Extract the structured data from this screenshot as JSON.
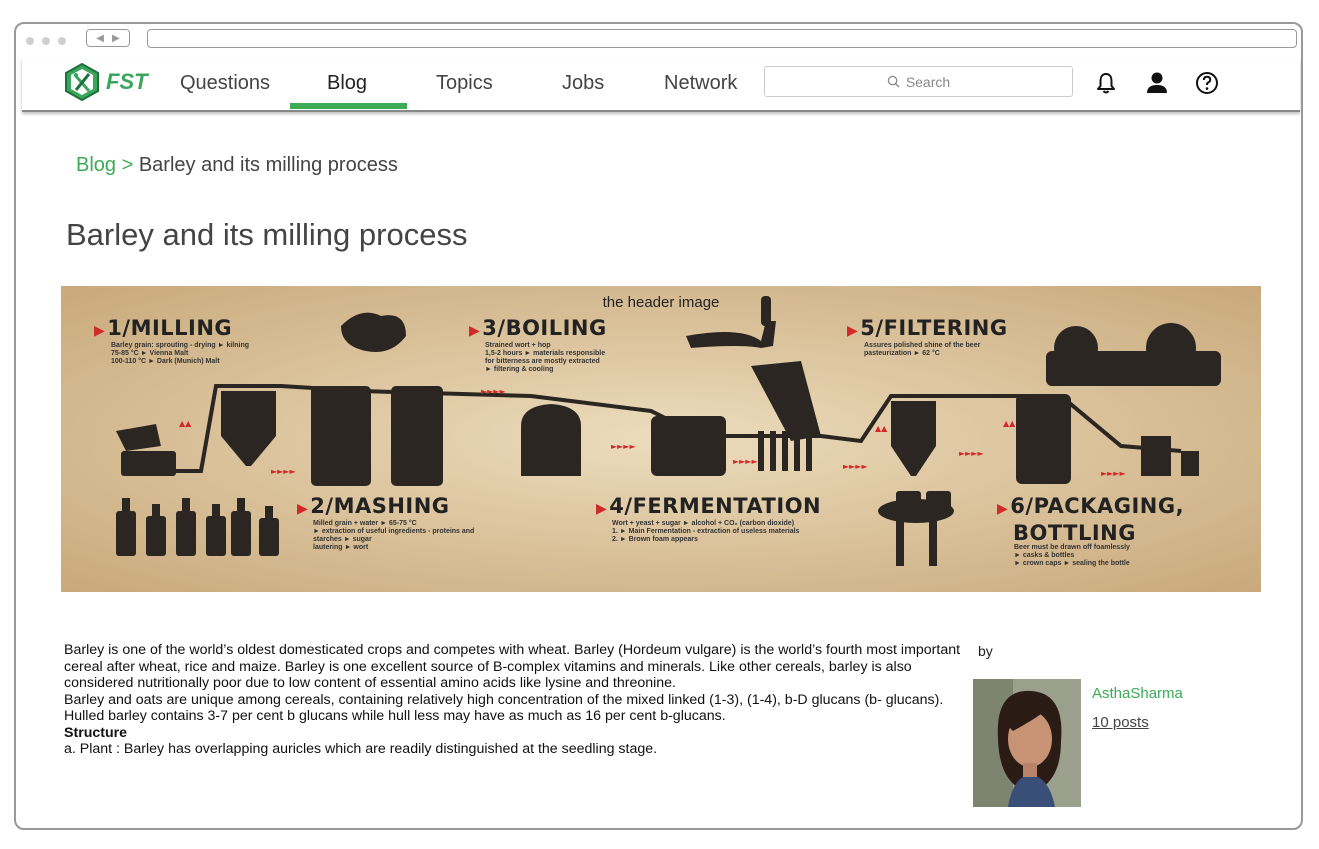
{
  "brand": {
    "logo_text": "FST",
    "logo_icon": "fork-knife-hexagon-icon",
    "accent": "#3dab55"
  },
  "nav": {
    "items": [
      "Questions",
      "Blog",
      "Topics",
      "Jobs",
      "Network"
    ],
    "active": "Blog",
    "search_placeholder": "Search"
  },
  "header_icons": [
    "bell-icon",
    "user-icon",
    "help-icon"
  ],
  "breadcrumb": {
    "parent": "Blog",
    "separator": ">",
    "current": "Barley and its milling process"
  },
  "page_title": "Barley and its milling process",
  "hero": {
    "caption": "the header image",
    "steps": [
      {
        "title": "1/MILLING",
        "lines": [
          "Barley grain: sprouting - drying ► kilning",
          "75-85 °C ► Vienna Malt",
          "100-110 °C ► Dark (Munich) Malt"
        ]
      },
      {
        "title": "2/MASHING",
        "lines": [
          "Milled grain + water ► 65-75 °C",
          "► extraction of useful ingredients - proteins and",
          "starches ► sugar",
          "lautering ► wort"
        ]
      },
      {
        "title": "3/BOILING",
        "lines": [
          "Strained wort + hop",
          "1,5-2 hours ► materials responsible",
          "for bitterness are mostly extracted",
          "► filtering & cooling"
        ]
      },
      {
        "title": "4/FERMENTATION",
        "lines": [
          "Wort + yeast + sugar ► alcohol + CO₂ (carbon dioxide)",
          "1. ► Main Fermentation - extraction of useless materials",
          "2. ► Brown foam appears"
        ]
      },
      {
        "title": "5/FILTERING",
        "lines": [
          "Assures polished shine of the beer",
          "pasteurization ► 62 °C"
        ]
      },
      {
        "title": "6/PACKAGING,",
        "title2": "BOTTLING",
        "lines": [
          "Beer must be drawn off foamlessly",
          "► casks & bottles",
          "► crown caps ► sealing the bottle"
        ]
      }
    ]
  },
  "article": {
    "paragraphs": [
      "Barley is one of the world’s oldest domesticated crops and competes with wheat. Barley (Hordeum vulgare) is the world’s fourth most important cereal after wheat, rice and maize. Barley is one excellent source of B-complex vitamins and minerals. Like other cereals, barley is also considered nutritionally poor due to low content of essential amino acids like lysine and threonine.",
      "Barley and oats are unique among cereals, containing relatively high concentration of the mixed linked (1-3), (1-4), b-D glucans (b- glucans). Hulled barley contains 3-7 per cent b glucans while hull less may have as much as 16 per cent b-glucans."
    ],
    "heading": "Structure",
    "after_heading": "a. Plant : Barley has overlapping auricles which are readily distinguished at the seedling stage."
  },
  "author": {
    "by_label": "by",
    "name": "AsthaSharma",
    "posts": "10 posts"
  }
}
